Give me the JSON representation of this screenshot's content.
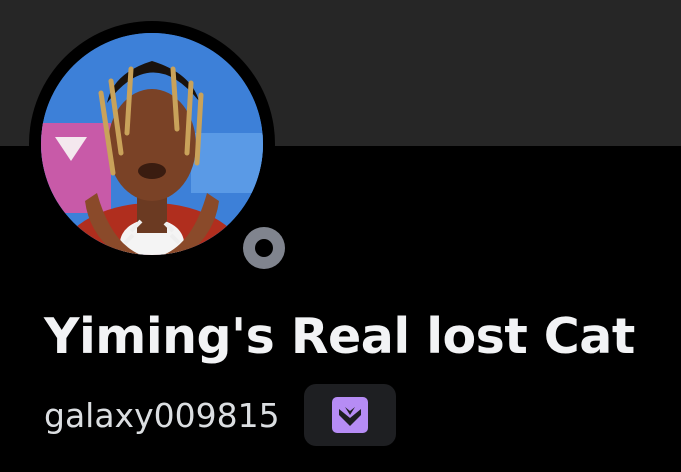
{
  "profile": {
    "display_name": "Yiming's Real lost Cat",
    "username": "galaxy009815",
    "status": "offline",
    "badge_icon": "hypesquad-shield-icon"
  },
  "colors": {
    "banner": "#262626",
    "background": "#000000",
    "status_offline": "#80848e",
    "badge": "#b68cf5",
    "display_name_text": "#f2f3f5",
    "username_text": "#dbdee1"
  }
}
